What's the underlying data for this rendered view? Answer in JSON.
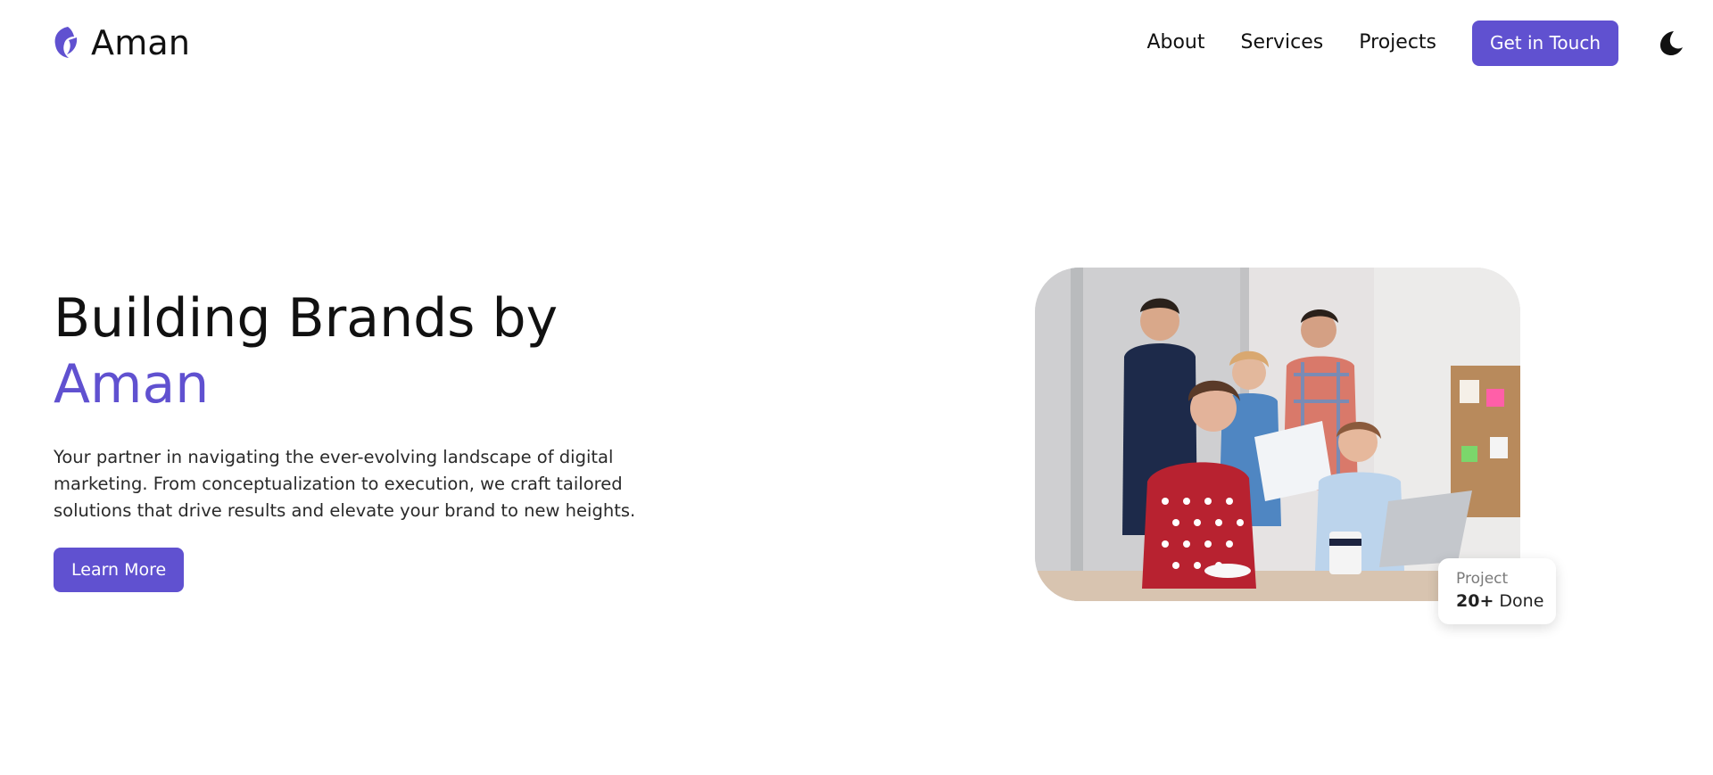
{
  "brand": {
    "name": "Aman",
    "accent_color": "#6051d0",
    "logo_icon": "crescent-logo-icon"
  },
  "nav": {
    "links": [
      {
        "label": "About"
      },
      {
        "label": "Services"
      },
      {
        "label": "Projects"
      }
    ],
    "cta_label": "Get in Touch",
    "theme_icon": "moon-icon"
  },
  "hero": {
    "title_line1": "Building Brands by",
    "title_accent": "Aman",
    "description": "Your partner in navigating the ever-evolving landscape of digital marketing. From conceptualization to execution, we craft tailored solutions that drive results and elevate your brand to new heights.",
    "button_label": "Learn More"
  },
  "stat": {
    "label": "Project",
    "value": "20+",
    "suffix": "Done"
  }
}
